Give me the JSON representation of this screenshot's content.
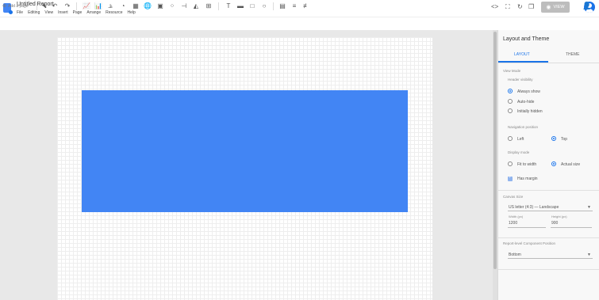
{
  "header": {
    "title": "Untitled Report",
    "menu": [
      "File",
      "Editing",
      "View",
      "Insert",
      "Page",
      "Arrange",
      "Resource",
      "Help"
    ],
    "view_button": "VIEW"
  },
  "toolbar": {
    "add_page": "Add a page"
  },
  "panel": {
    "title": "Layout and Theme",
    "tabs": [
      "LAYOUT",
      "THEME"
    ],
    "view_mode": {
      "section": "View Mode",
      "header_label": "Header visibility",
      "options": [
        "Always show",
        "Auto-hide",
        "Initially hidden"
      ],
      "selected": "Always show"
    },
    "navigation": {
      "label": "Navigation position",
      "options": [
        "Left",
        "Top"
      ],
      "selected": "Top"
    },
    "display": {
      "label": "Display mode",
      "options": [
        "Fit to width",
        "Actual size"
      ],
      "selected": "Actual size"
    },
    "margin": {
      "label": "Has margin",
      "checked": true
    },
    "canvas_size": {
      "section": "Canvas Size",
      "select_value": "US letter (4:3) — Landscape",
      "width_label": "Width (px)",
      "width_value": "1200",
      "height_label": "Height (px)",
      "height_value": "900"
    },
    "report_component": {
      "section": "Report-level Component Position",
      "value": "Bottom"
    }
  },
  "colors": {
    "accent": "#1a73e8",
    "canvas_shape": "#4285f4"
  }
}
